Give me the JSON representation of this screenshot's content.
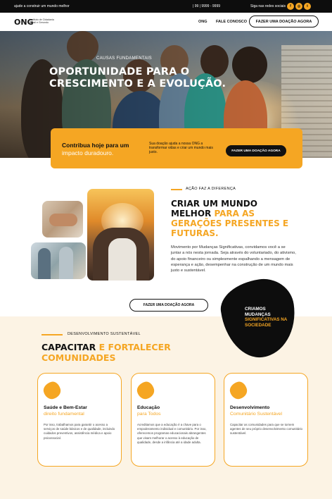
{
  "topbar": {
    "tagline": "ajude a construir um mundo melhor",
    "phone": "| 99 | 9999 - 9999",
    "social_label": "Siga nas redes sociais",
    "social_icons": [
      "facebook-icon",
      "instagram-icon",
      "twitter-icon"
    ],
    "social_glyphs": [
      "f",
      "◎",
      "t"
    ]
  },
  "nav": {
    "logo": "ONG",
    "logo_sub": "Instituto de Cidadania Brasil e Gerundo",
    "links": [
      "ONG",
      "FALE CONOSCO"
    ],
    "cta": "FAZER UMA DOAÇÃO AGORA"
  },
  "hero": {
    "kicker": "CAUSAS FUNDAMENTAIS",
    "title": "OPORTUNIDADE PARA O CRESCIMENTO E A EVOLUÇÃO."
  },
  "donate": {
    "title": "Contribua hoje para um",
    "title2": "impacto duradouro.",
    "text": "Sua doação ajuda a nossa ONG a transformar vidas e criar um mundo mais justo.",
    "button": "FAZER UMA DOAÇÃO AGORA"
  },
  "mission": {
    "kicker": "AÇÃO FAZ A DIFERENÇA",
    "title_plain": "CRIAR UM MUNDO MELHOR ",
    "title_highlight": "PARA AS GERAÇÕES PRESENTES E FUTURAS.",
    "text": "Movimento por Mudanças Significativas, convidamos você a se juntar a nós nesta jornada. Seja através do voluntariado, do ativismo, do apoio financeiro ou simplesmente espalhando a mensagem de esperança e ação, desempenhar na construção de um mundo mais justo e sustentável.",
    "button": "FAZER UMA DOAÇÃO AGORA"
  },
  "badge": {
    "line1": "CRIAMOS",
    "line2": "MUDANÇAS",
    "highlight": "SIGNIFICATIVAS NA SOCIEDADE"
  },
  "development": {
    "kicker": "DESENVOLVIMENTO  SUSTENTÁVEL",
    "title_plain": "CAPACITAR ",
    "title_highlight": "E FORTALECER COMUNIDADES"
  },
  "cards": [
    {
      "title": "Saúde e Bem-Estar",
      "subtitle": "direito fundamental",
      "text": "Por isso, trabalhamos para garantir o acesso a serviços de saúde básicos e de qualidade, incluindo cuidados preventivos, assistência médica e apoio psicossocial."
    },
    {
      "title": "Educação",
      "subtitle": "para Todos",
      "text": "Acreditamos que a educação é a chave para o empoderamento individual e comunitário. Por isso, oferecemos programas educacionais abrangentes que visam melhorar o acesso à educação de qualidade, desde a infância até a idade adulta."
    },
    {
      "title": "Desenvolvimento",
      "subtitle": "Comunitário Sustentável",
      "text": "Capacitar as comunidades para que se tornem agentes de seu próprio desenvolvimento comunitário sustentável."
    }
  ],
  "colors": {
    "accent": "#f5a623",
    "dark": "#0d0d0d",
    "cream": "#fcf3e4"
  }
}
